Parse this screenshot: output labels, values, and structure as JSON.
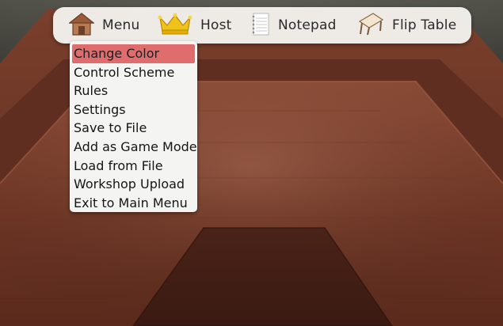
{
  "toolbar": {
    "items": [
      {
        "label": "Menu",
        "icon": "house-icon"
      },
      {
        "label": "Host",
        "icon": "crown-icon"
      },
      {
        "label": "Notepad",
        "icon": "notepad-icon"
      },
      {
        "label": "Flip Table",
        "icon": "flip-table-icon"
      }
    ]
  },
  "menu": {
    "selected": "Change Color",
    "items": [
      "Change Color",
      "Control Scheme",
      "Rules",
      "Settings",
      "Save to File",
      "Add as Game Mode",
      "Load from File",
      "Workshop Upload",
      "Exit to Main Menu"
    ]
  },
  "colors": {
    "highlight": "#e06d6d",
    "toolbar_bg": "#f8f8f6",
    "wood_light": "#8a4a35",
    "wood_dark": "#3a1c14"
  }
}
